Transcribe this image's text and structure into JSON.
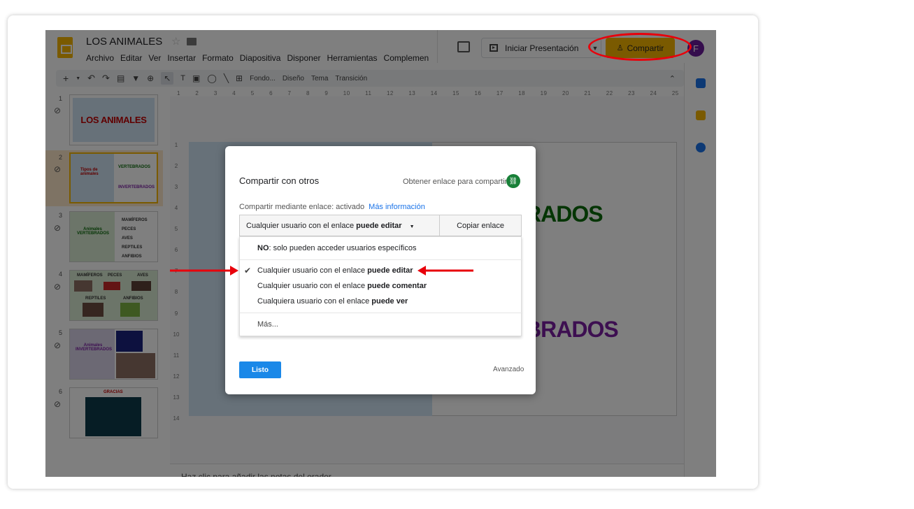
{
  "app": {
    "doc_title": "LOS ANIMALES",
    "menu": [
      "Archivo",
      "Editar",
      "Ver",
      "Insertar",
      "Formato",
      "Diapositiva",
      "Disponer",
      "Herramientas",
      "Complemen"
    ],
    "present_label": "Iniciar Presentación",
    "share_label": "Compartir",
    "avatar_letter": "F"
  },
  "toolbar": {
    "items": [
      "Fondo...",
      "Diseño",
      "Tema",
      "Transición"
    ]
  },
  "ruler_h": [
    "1",
    "2",
    "3",
    "4",
    "5",
    "6",
    "7",
    "8",
    "9",
    "10",
    "11",
    "12",
    "13",
    "14",
    "15",
    "16",
    "17",
    "18",
    "19",
    "20",
    "21",
    "22",
    "23",
    "24",
    "25"
  ],
  "ruler_v": [
    "1",
    "2",
    "3",
    "4",
    "5",
    "6",
    "7",
    "8",
    "9",
    "10",
    "11",
    "12",
    "13",
    "14"
  ],
  "slides": {
    "numbers": [
      "1",
      "2",
      "3",
      "4",
      "5",
      "6"
    ],
    "s1_title": "LOS ANIMALES",
    "s2_left": "Tipos de animales",
    "s2_vert": "VERTEBRADOS",
    "s2_invert": "INVERTEBRADOS",
    "s3_title": "Animales VERTEBRADOS",
    "s3_items": [
      "MAMÍFEROS",
      "PECES",
      "AVES",
      "REPTILES",
      "ANFIBIOS"
    ],
    "s4_labels": [
      "MAMÍFEROS",
      "PECES",
      "AVES",
      "REPTILES",
      "ANFIBIOS"
    ],
    "s5_title": "Animales INVERTEBRADOS",
    "s6_title": "GRACIAS"
  },
  "canvas": {
    "big_green": "RADOS",
    "big_purple": "BRADOS",
    "notes": "Haz clic para añadir las notas del orador"
  },
  "dialog": {
    "title": "Compartir con otros",
    "get_link": "Obtener enlace para compartir",
    "status": "Compartir mediante enlace: activado",
    "more_info": "Más información",
    "selected_prefix": "Cualquier usuario con el enlace ",
    "selected_bold": "puede editar",
    "copy_link": "Copiar enlace",
    "menu": {
      "no_bold": "NO",
      "no_rest": ": solo pueden acceder usuarios específicos",
      "opt1_prefix": "Cualquier usuario con el enlace ",
      "opt1_bold": "puede editar",
      "opt2_prefix": "Cualquier usuario con el enlace ",
      "opt2_bold": "puede comentar",
      "opt3_prefix": "Cualquiera usuario con el enlace ",
      "opt3_bold": "puede ver",
      "more": "Más..."
    },
    "done": "Listo",
    "advanced": "Avanzado"
  },
  "colors": {
    "accent_yellow": "#f4b400",
    "annotation_red": "#e8000b",
    "button_blue": "#1a88e8"
  }
}
